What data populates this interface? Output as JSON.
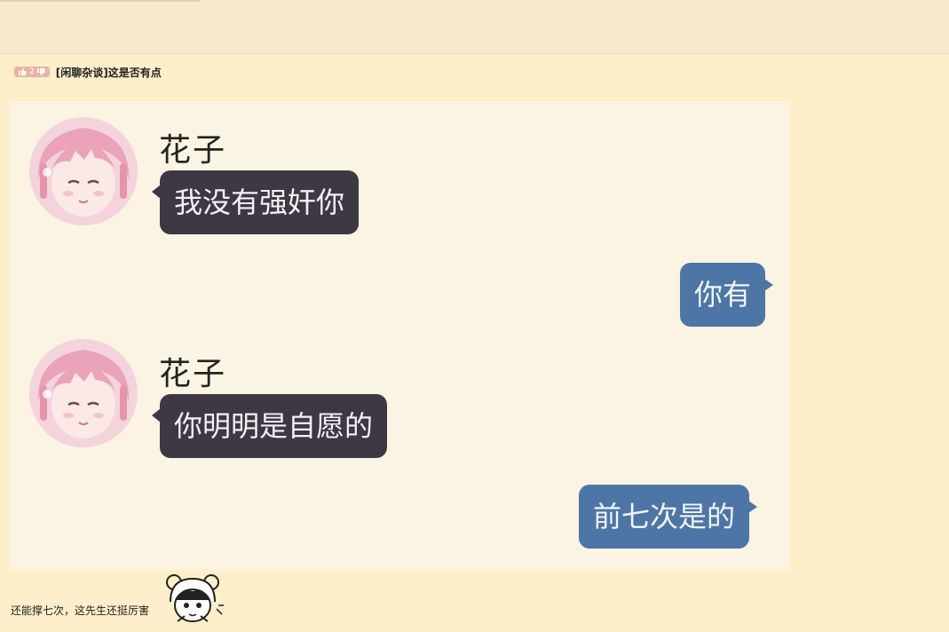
{
  "post": {
    "vote_count": "2",
    "title": "[闲聊杂谈]这是否有点"
  },
  "chat": {
    "messages": [
      {
        "speaker": "花子",
        "text": "我没有强奸你"
      },
      {
        "text": "你有"
      },
      {
        "speaker": "花子",
        "text": "你明明是自愿的"
      },
      {
        "text": "前七次是的"
      }
    ]
  },
  "comment": {
    "text": "还能撑七次，这先生还挺厉害"
  },
  "colors": {
    "page_bg": "#fdefc9",
    "screenshot_bg": "#fcf4e2",
    "left_bubble": "#3e3845",
    "right_bubble": "#4d76a6"
  }
}
